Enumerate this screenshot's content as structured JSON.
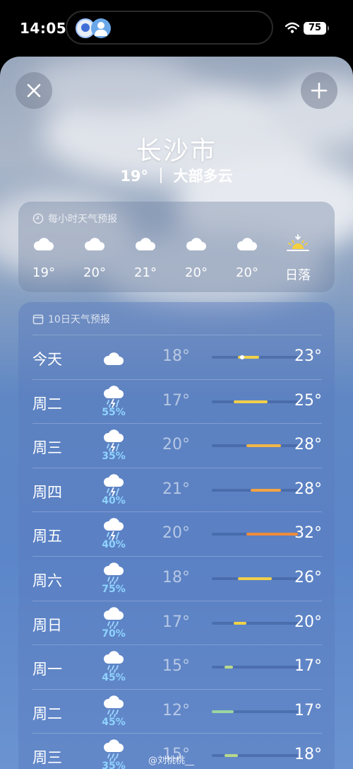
{
  "status": {
    "time": "14:05",
    "battery": "75"
  },
  "city": "长沙市",
  "current": "19° ｜ 大部多云",
  "hourly": {
    "title": "每小时天气预报",
    "items": [
      {
        "label": "19°",
        "icon": "cloud-icon"
      },
      {
        "label": "20°",
        "icon": "cloud-icon"
      },
      {
        "label": "21°",
        "icon": "cloud-icon"
      },
      {
        "label": "20°",
        "icon": "cloud-icon"
      },
      {
        "label": "20°",
        "icon": "cloud-icon"
      },
      {
        "label": "日落",
        "icon": "sunset-icon"
      }
    ]
  },
  "daily": {
    "title": "10日天气预报",
    "rows": [
      {
        "day": "今天",
        "icon": "cloud-icon",
        "pct": "",
        "lo": "18°",
        "hi": "23°",
        "range": [
          18,
          23
        ],
        "current": 19,
        "color": "#f0d24a"
      },
      {
        "day": "周二",
        "icon": "thunder-rain-icon",
        "pct": "55%",
        "lo": "17°",
        "hi": "25°",
        "range": [
          17,
          25
        ],
        "color": "#f2cf4a"
      },
      {
        "day": "周三",
        "icon": "thunder-rain-icon",
        "pct": "35%",
        "lo": "20°",
        "hi": "28°",
        "range": [
          20,
          28
        ],
        "color": "#f2b545"
      },
      {
        "day": "周四",
        "icon": "thunder-rain-icon",
        "pct": "40%",
        "lo": "21°",
        "hi": "28°",
        "range": [
          21,
          28
        ],
        "color": "#f2a443"
      },
      {
        "day": "周五",
        "icon": "thunder-rain-icon",
        "pct": "40%",
        "lo": "20°",
        "hi": "32°",
        "range": [
          20,
          32
        ],
        "color": "#ef8b3c"
      },
      {
        "day": "周六",
        "icon": "rain-icon",
        "pct": "75%",
        "lo": "18°",
        "hi": "26°",
        "range": [
          18,
          26
        ],
        "color": "#f2cf4a"
      },
      {
        "day": "周日",
        "icon": "rain-icon",
        "pct": "70%",
        "lo": "17°",
        "hi": "20°",
        "range": [
          17,
          20
        ],
        "color": "#f0d24a"
      },
      {
        "day": "周一",
        "icon": "rain-icon",
        "pct": "45%",
        "lo": "15°",
        "hi": "17°",
        "range": [
          15,
          17
        ],
        "color": "#b9d98a"
      },
      {
        "day": "周二",
        "icon": "rain-icon",
        "pct": "45%",
        "lo": "12°",
        "hi": "17°",
        "range": [
          12,
          17
        ],
        "color": "#9ad6a0"
      },
      {
        "day": "周三",
        "icon": "rain-icon",
        "pct": "35%",
        "lo": "15°",
        "hi": "18°",
        "range": [
          15,
          18
        ],
        "color": "#b9d98a"
      }
    ],
    "scale": [
      12,
      32
    ]
  },
  "watermark": "@刘桃桃__"
}
